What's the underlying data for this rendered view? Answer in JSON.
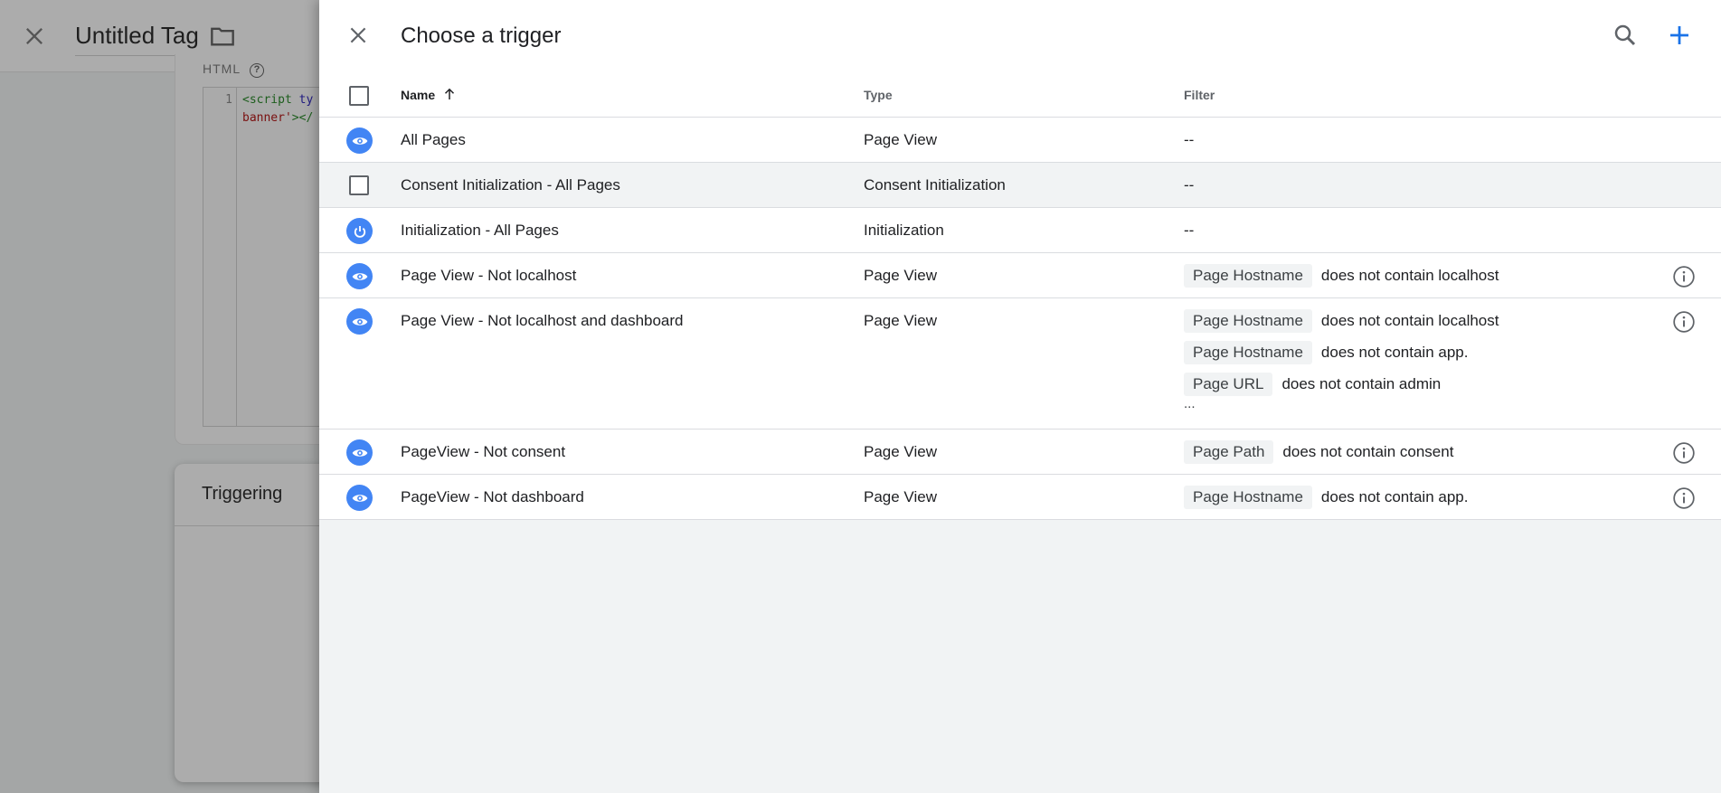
{
  "background": {
    "tag_title": "Untitled Tag",
    "html_label": "HTML",
    "help_glyph": "?",
    "code_line_number": "1",
    "code_line1_tag": "<script ",
    "code_line1_attr": "ty",
    "code_line2_str": "banner'",
    "code_line2_tag": "></",
    "triggering_title": "Triggering"
  },
  "panel": {
    "title": "Choose a trigger",
    "icons": {
      "close": "close-icon",
      "search": "search-icon",
      "add": "plus-icon"
    },
    "accent_color": "#4285f4"
  },
  "table": {
    "columns": {
      "name": "Name",
      "type": "Type",
      "filter": "Filter"
    },
    "sort": {
      "column": "Name",
      "direction": "ascending"
    },
    "rows": [
      {
        "icon": "eye-icon",
        "name": "All Pages",
        "type": "Page View",
        "filter_empty": "--",
        "conditions": []
      },
      {
        "icon": "checkbox",
        "name": "Consent Initialization - All Pages",
        "type": "Consent Initialization",
        "filter_empty": "--",
        "conditions": []
      },
      {
        "icon": "power-icon",
        "name": "Initialization - All Pages",
        "type": "Initialization",
        "filter_empty": "--",
        "conditions": []
      },
      {
        "icon": "eye-icon",
        "name": "Page View - Not localhost",
        "type": "Page View",
        "conditions": [
          {
            "variable": "Page Hostname",
            "text": "does not contain localhost"
          }
        ]
      },
      {
        "icon": "eye-icon",
        "name": "Page View - Not localhost and dashboard",
        "type": "Page View",
        "conditions": [
          {
            "variable": "Page Hostname",
            "text": "does not contain localhost"
          },
          {
            "variable": "Page Hostname",
            "text": "does not contain app."
          },
          {
            "variable": "Page URL",
            "text": "does not contain admin"
          }
        ],
        "more": "..."
      },
      {
        "icon": "eye-icon",
        "name": "PageView - Not consent",
        "type": "Page View",
        "conditions": [
          {
            "variable": "Page Path",
            "text": "does not contain consent"
          }
        ]
      },
      {
        "icon": "eye-icon",
        "name": "PageView - Not dashboard",
        "type": "Page View",
        "conditions": [
          {
            "variable": "Page Hostname",
            "text": "does not contain app."
          }
        ]
      }
    ]
  }
}
